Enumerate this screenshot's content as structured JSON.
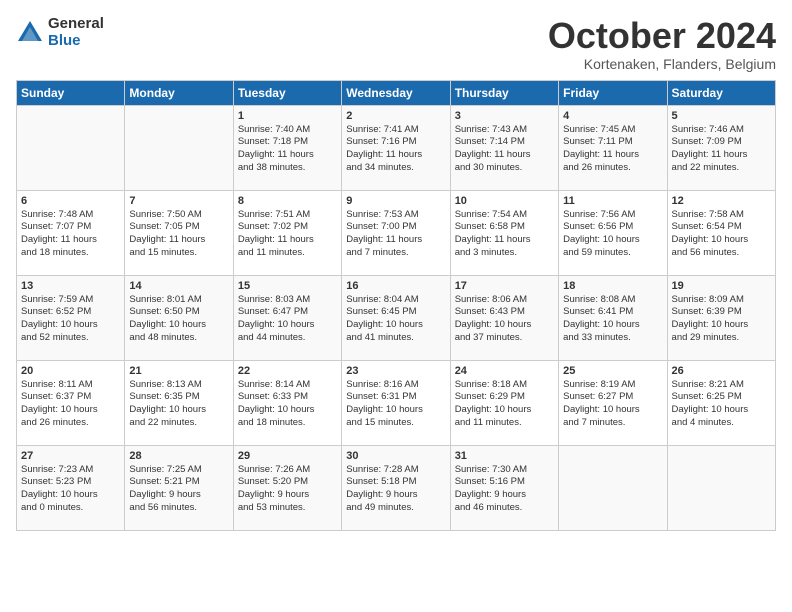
{
  "header": {
    "logo_general": "General",
    "logo_blue": "Blue",
    "month": "October 2024",
    "location": "Kortenaken, Flanders, Belgium"
  },
  "weekdays": [
    "Sunday",
    "Monday",
    "Tuesday",
    "Wednesday",
    "Thursday",
    "Friday",
    "Saturday"
  ],
  "weeks": [
    [
      {
        "day": "",
        "info": ""
      },
      {
        "day": "",
        "info": ""
      },
      {
        "day": "1",
        "info": "Sunrise: 7:40 AM\nSunset: 7:18 PM\nDaylight: 11 hours\nand 38 minutes."
      },
      {
        "day": "2",
        "info": "Sunrise: 7:41 AM\nSunset: 7:16 PM\nDaylight: 11 hours\nand 34 minutes."
      },
      {
        "day": "3",
        "info": "Sunrise: 7:43 AM\nSunset: 7:14 PM\nDaylight: 11 hours\nand 30 minutes."
      },
      {
        "day": "4",
        "info": "Sunrise: 7:45 AM\nSunset: 7:11 PM\nDaylight: 11 hours\nand 26 minutes."
      },
      {
        "day": "5",
        "info": "Sunrise: 7:46 AM\nSunset: 7:09 PM\nDaylight: 11 hours\nand 22 minutes."
      }
    ],
    [
      {
        "day": "6",
        "info": "Sunrise: 7:48 AM\nSunset: 7:07 PM\nDaylight: 11 hours\nand 18 minutes."
      },
      {
        "day": "7",
        "info": "Sunrise: 7:50 AM\nSunset: 7:05 PM\nDaylight: 11 hours\nand 15 minutes."
      },
      {
        "day": "8",
        "info": "Sunrise: 7:51 AM\nSunset: 7:02 PM\nDaylight: 11 hours\nand 11 minutes."
      },
      {
        "day": "9",
        "info": "Sunrise: 7:53 AM\nSunset: 7:00 PM\nDaylight: 11 hours\nand 7 minutes."
      },
      {
        "day": "10",
        "info": "Sunrise: 7:54 AM\nSunset: 6:58 PM\nDaylight: 11 hours\nand 3 minutes."
      },
      {
        "day": "11",
        "info": "Sunrise: 7:56 AM\nSunset: 6:56 PM\nDaylight: 10 hours\nand 59 minutes."
      },
      {
        "day": "12",
        "info": "Sunrise: 7:58 AM\nSunset: 6:54 PM\nDaylight: 10 hours\nand 56 minutes."
      }
    ],
    [
      {
        "day": "13",
        "info": "Sunrise: 7:59 AM\nSunset: 6:52 PM\nDaylight: 10 hours\nand 52 minutes."
      },
      {
        "day": "14",
        "info": "Sunrise: 8:01 AM\nSunset: 6:50 PM\nDaylight: 10 hours\nand 48 minutes."
      },
      {
        "day": "15",
        "info": "Sunrise: 8:03 AM\nSunset: 6:47 PM\nDaylight: 10 hours\nand 44 minutes."
      },
      {
        "day": "16",
        "info": "Sunrise: 8:04 AM\nSunset: 6:45 PM\nDaylight: 10 hours\nand 41 minutes."
      },
      {
        "day": "17",
        "info": "Sunrise: 8:06 AM\nSunset: 6:43 PM\nDaylight: 10 hours\nand 37 minutes."
      },
      {
        "day": "18",
        "info": "Sunrise: 8:08 AM\nSunset: 6:41 PM\nDaylight: 10 hours\nand 33 minutes."
      },
      {
        "day": "19",
        "info": "Sunrise: 8:09 AM\nSunset: 6:39 PM\nDaylight: 10 hours\nand 29 minutes."
      }
    ],
    [
      {
        "day": "20",
        "info": "Sunrise: 8:11 AM\nSunset: 6:37 PM\nDaylight: 10 hours\nand 26 minutes."
      },
      {
        "day": "21",
        "info": "Sunrise: 8:13 AM\nSunset: 6:35 PM\nDaylight: 10 hours\nand 22 minutes."
      },
      {
        "day": "22",
        "info": "Sunrise: 8:14 AM\nSunset: 6:33 PM\nDaylight: 10 hours\nand 18 minutes."
      },
      {
        "day": "23",
        "info": "Sunrise: 8:16 AM\nSunset: 6:31 PM\nDaylight: 10 hours\nand 15 minutes."
      },
      {
        "day": "24",
        "info": "Sunrise: 8:18 AM\nSunset: 6:29 PM\nDaylight: 10 hours\nand 11 minutes."
      },
      {
        "day": "25",
        "info": "Sunrise: 8:19 AM\nSunset: 6:27 PM\nDaylight: 10 hours\nand 7 minutes."
      },
      {
        "day": "26",
        "info": "Sunrise: 8:21 AM\nSunset: 6:25 PM\nDaylight: 10 hours\nand 4 minutes."
      }
    ],
    [
      {
        "day": "27",
        "info": "Sunrise: 7:23 AM\nSunset: 5:23 PM\nDaylight: 10 hours\nand 0 minutes."
      },
      {
        "day": "28",
        "info": "Sunrise: 7:25 AM\nSunset: 5:21 PM\nDaylight: 9 hours\nand 56 minutes."
      },
      {
        "day": "29",
        "info": "Sunrise: 7:26 AM\nSunset: 5:20 PM\nDaylight: 9 hours\nand 53 minutes."
      },
      {
        "day": "30",
        "info": "Sunrise: 7:28 AM\nSunset: 5:18 PM\nDaylight: 9 hours\nand 49 minutes."
      },
      {
        "day": "31",
        "info": "Sunrise: 7:30 AM\nSunset: 5:16 PM\nDaylight: 9 hours\nand 46 minutes."
      },
      {
        "day": "",
        "info": ""
      },
      {
        "day": "",
        "info": ""
      }
    ]
  ]
}
